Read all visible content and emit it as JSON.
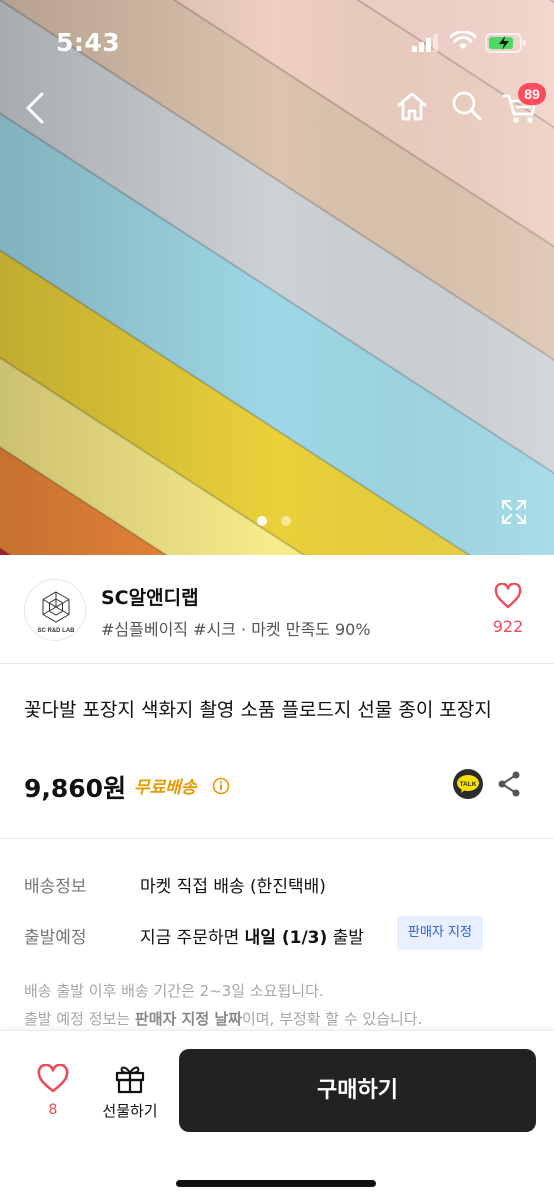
{
  "status_bar": {
    "time": "5:43"
  },
  "nav": {
    "cart_badge": "89"
  },
  "hero": {
    "slide_count": 2,
    "active_slide": 1
  },
  "seller": {
    "name": "SC알앤디랩",
    "tags": "#심플베이직 #시크 · 마켓 만족도 90%",
    "logo_text": "SC R&D LAB",
    "like_count": "922"
  },
  "product": {
    "title": "꽃다발 포장지 색화지 촬영 소품 플로드지 선물 종이 포장지",
    "price": "9,860원",
    "shipping_badge": "무료배송"
  },
  "delivery": {
    "shipping_label": "배송정보",
    "shipping_value": "마켓 직접 배송 (한진택배)",
    "departure_label": "출발예정",
    "departure_prefix": "지금 주문하면 ",
    "departure_bold": "내일 (1/3)",
    "departure_suffix": " 출발",
    "departure_badge": "판매자 지정",
    "note_line1": "배송 출발 이후 배송 기간은 2~3일 소요됩니다.",
    "note_line2_prefix": "출발 예정 정보는 ",
    "note_line2_bold": "판매자 지정 날짜",
    "note_line2_suffix": "이며, 부정확 할 수 있습니다."
  },
  "bottom_bar": {
    "like_count": "8",
    "gift_label": "선물하기",
    "buy_label": "구매하기"
  },
  "colors": {
    "accent_pink": "#ef4b59",
    "free_shipping": "#e69a00",
    "badge_blue": "#2c5fd6",
    "buy_button": "#222222"
  },
  "icons": [
    "back-icon",
    "home-icon",
    "search-icon",
    "cart-icon",
    "expand-icon",
    "heart-icon",
    "info-icon",
    "kakao-talk-icon",
    "share-icon",
    "gift-icon"
  ]
}
